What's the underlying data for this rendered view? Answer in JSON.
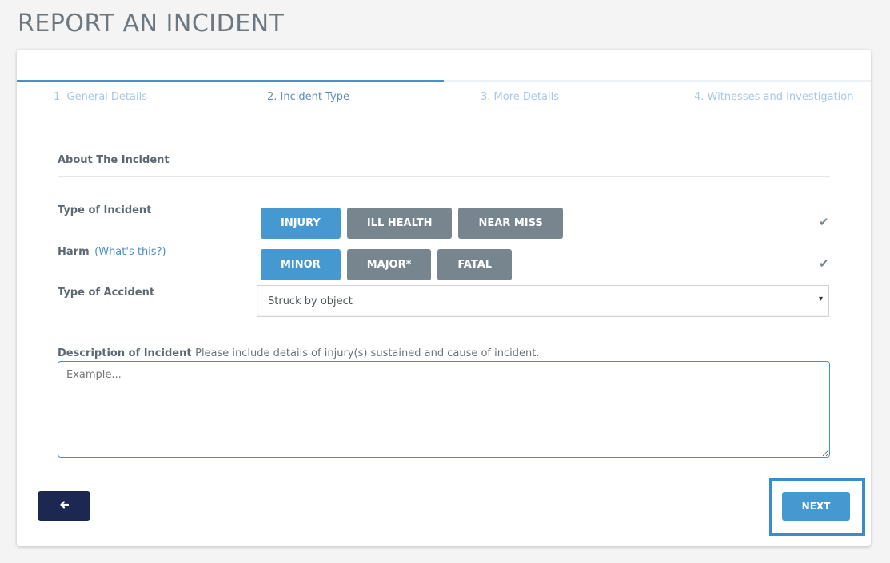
{
  "page": {
    "title": "REPORT AN INCIDENT"
  },
  "progress": {
    "current_step": 2,
    "total_steps": 4,
    "fraction": 0.5
  },
  "steps": [
    {
      "label": "1. General Details"
    },
    {
      "label": "2. Incident Type"
    },
    {
      "label": "3. More Details"
    },
    {
      "label": "4. Witnesses and Investigation"
    }
  ],
  "section": {
    "title": "About The Incident"
  },
  "incident_type": {
    "label": "Type of Incident",
    "options": [
      "INJURY",
      "ILL HEALTH",
      "NEAR MISS"
    ],
    "selected": "INJURY",
    "valid_icon": "check-icon"
  },
  "harm": {
    "label": "Harm",
    "help_link": "(What's this?)",
    "options": [
      "MINOR",
      "MAJOR*",
      "FATAL"
    ],
    "selected": "MINOR",
    "valid_icon": "check-icon"
  },
  "accident_type": {
    "label": "Type of Accident",
    "value": "Struck by object",
    "caret": "▾"
  },
  "description": {
    "label": "Description of Incident",
    "hint": "Please include details of injury(s) sustained and cause of incident.",
    "placeholder": "Example..."
  },
  "nav": {
    "back_icon": "arrow-left-icon",
    "back_glyph": "🡐",
    "next_label": "NEXT"
  },
  "colors": {
    "accent": "#4698d0",
    "unselected": "#77868e",
    "back_button": "#1c2852",
    "highlight": "#3a8dc9"
  }
}
